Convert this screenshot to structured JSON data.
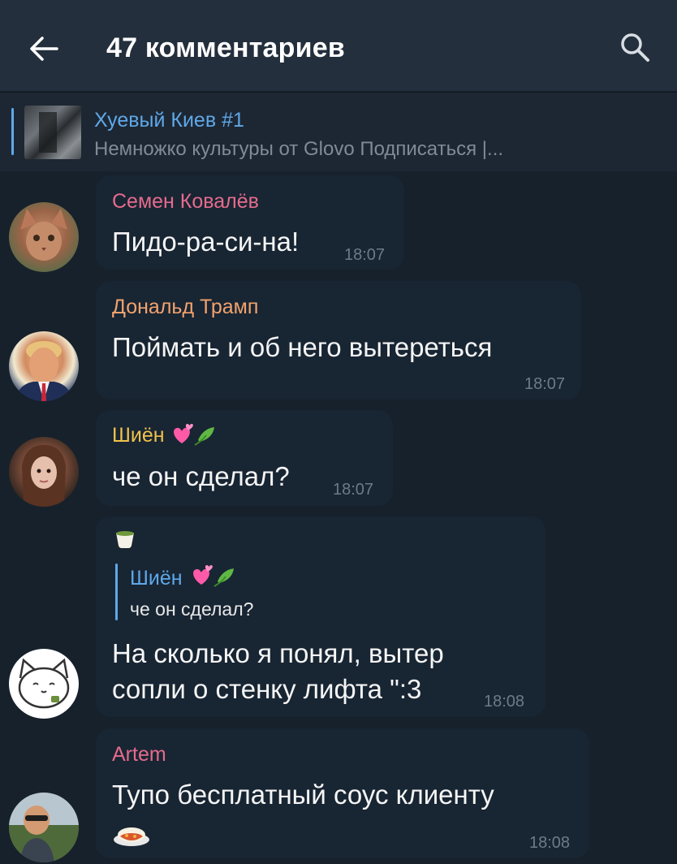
{
  "header": {
    "title": "47 комментариев"
  },
  "pinned": {
    "title": "Хуевый Киев #1",
    "subtitle": "Немножко культуры от Glovo  Подписаться |..."
  },
  "colors": {
    "accent": "#5fa8e8",
    "bubble": "#182533",
    "background": "#17212b",
    "name_semen": "#e56b8c",
    "name_donald": "#f2a36d",
    "name_shien": "#f0c24a",
    "name_artem": "#e56b8c"
  },
  "messages": [
    {
      "author": "Семен Ковалёв",
      "text": "Пидо-ра-си-на!",
      "time": "18:07",
      "avatar_icon": "cat-photo"
    },
    {
      "author": "Дональд Трамп",
      "text": "Поймать и об него вытереться",
      "time": "18:07",
      "avatar_icon": "man-photo"
    },
    {
      "author": "Шиён",
      "author_emojis": "heart-leaf-emojis",
      "text": "че он сделал?",
      "time": "18:07",
      "avatar_icon": "girl-photo"
    },
    {
      "author_icon": "tea-cup-emoji",
      "reply": {
        "author": "Шиён",
        "text": "че он сделал?"
      },
      "text_line1": "На сколько я понял, вытер",
      "text_line2": "сопли о стенку лифта \":3",
      "time": "18:08",
      "avatar_icon": "cartoon-cat"
    },
    {
      "author": "Artem",
      "text": "Тупо бесплатный соус клиенту",
      "emoji": "food-plate-emoji",
      "time": "18:08",
      "avatar_icon": "man-selfie-photo"
    }
  ]
}
